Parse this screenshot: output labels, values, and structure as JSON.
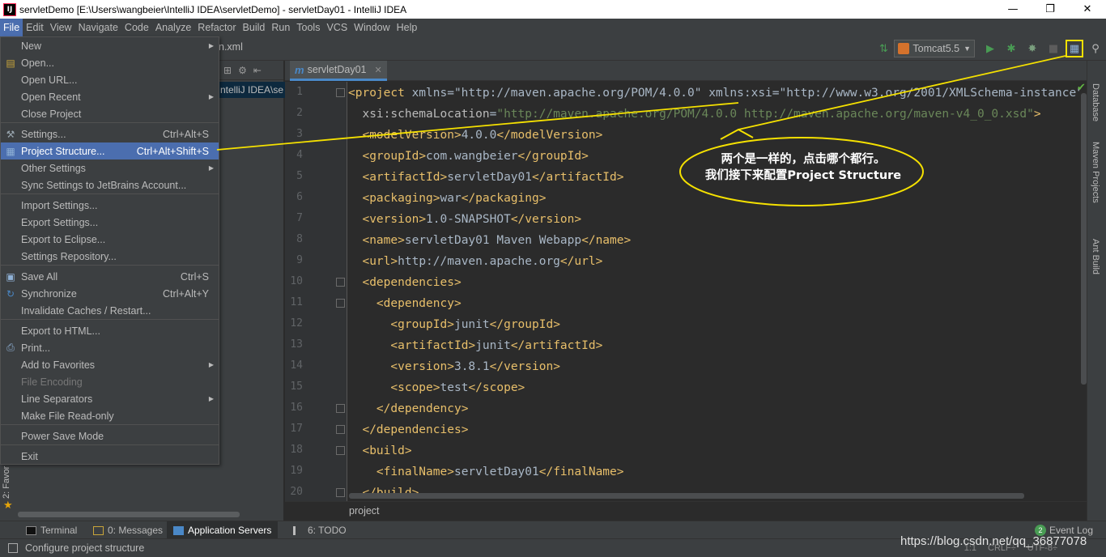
{
  "window": {
    "title": "servletDemo [E:\\Users\\wangbeier\\IntelliJ IDEA\\servletDemo] - servletDay01 - IntelliJ IDEA",
    "app_icon": "IJ"
  },
  "menubar": [
    "File",
    "Edit",
    "View",
    "Navigate",
    "Code",
    "Analyze",
    "Refactor",
    "Build",
    "Run",
    "Tools",
    "VCS",
    "Window",
    "Help"
  ],
  "navbar": {
    "breadcrumb_tail": "n.xml"
  },
  "run_config": {
    "name": "Tomcat5.5"
  },
  "project_panel": {
    "path_fragment": "ntelliJ IDEA\\se"
  },
  "editor": {
    "tab_label": "servletDay01",
    "breadcrumb": "project",
    "line_numbers": [
      "1",
      "2",
      "3",
      "4",
      "5",
      "6",
      "7",
      "8",
      "9",
      "10",
      "11",
      "12",
      "13",
      "14",
      "15",
      "16",
      "17",
      "18",
      "19",
      "20"
    ],
    "lines": [
      "<project xmlns=\"http://maven.apache.org/POM/4.0.0\" xmlns:xsi=\"http://www.w3.org/2001/XMLSchema-instance\"",
      "  xsi:schemaLocation=\"http://maven.apache.org/POM/4.0.0 http://maven.apache.org/maven-v4_0_0.xsd\">",
      "  <modelVersion>4.0.0</modelVersion>",
      "  <groupId>com.wangbeier</groupId>",
      "  <artifactId>servletDay01</artifactId>",
      "  <packaging>war</packaging>",
      "  <version>1.0-SNAPSHOT</version>",
      "  <name>servletDay01 Maven Webapp</name>",
      "  <url>http://maven.apache.org</url>",
      "  <dependencies>",
      "    <dependency>",
      "      <groupId>junit</groupId>",
      "      <artifactId>junit</artifactId>",
      "      <version>3.8.1</version>",
      "      <scope>test</scope>",
      "    </dependency>",
      "  </dependencies>",
      "  <build>",
      "    <finalName>servletDay01</finalName>",
      "  </build>"
    ]
  },
  "file_menu": {
    "items": [
      {
        "label": "New",
        "shortcut": "",
        "submenu": true
      },
      {
        "label": "Open...",
        "shortcut": "",
        "icon": "folder-icon"
      },
      {
        "label": "Open URL...",
        "shortcut": ""
      },
      {
        "label": "Open Recent",
        "shortcut": "",
        "submenu": true
      },
      {
        "label": "Close Project",
        "shortcut": ""
      },
      {
        "label": "Settings...",
        "shortcut": "Ctrl+Alt+S",
        "icon": "wrench-icon"
      },
      {
        "label": "Project Structure...",
        "shortcut": "Ctrl+Alt+Shift+S",
        "icon": "project-structure-icon",
        "selected": true
      },
      {
        "label": "Other Settings",
        "shortcut": "",
        "submenu": true
      },
      {
        "label": "Sync Settings to JetBrains Account...",
        "shortcut": ""
      },
      {
        "label": "Import Settings...",
        "shortcut": ""
      },
      {
        "label": "Export Settings...",
        "shortcut": ""
      },
      {
        "label": "Export to Eclipse...",
        "shortcut": ""
      },
      {
        "label": "Settings Repository...",
        "shortcut": ""
      },
      {
        "label": "Save All",
        "shortcut": "Ctrl+S",
        "icon": "save-icon"
      },
      {
        "label": "Synchronize",
        "shortcut": "Ctrl+Alt+Y",
        "icon": "sync-icon"
      },
      {
        "label": "Invalidate Caches / Restart...",
        "shortcut": ""
      },
      {
        "label": "Export to HTML...",
        "shortcut": ""
      },
      {
        "label": "Print...",
        "shortcut": "",
        "icon": "print-icon"
      },
      {
        "label": "Add to Favorites",
        "shortcut": "",
        "submenu": true
      },
      {
        "label": "File Encoding",
        "shortcut": "",
        "disabled": true
      },
      {
        "label": "Line Separators",
        "shortcut": "",
        "submenu": true
      },
      {
        "label": "Make File Read-only",
        "shortcut": ""
      },
      {
        "label": "Power Save Mode",
        "shortcut": ""
      },
      {
        "label": "Exit",
        "shortcut": ""
      }
    ]
  },
  "right_strip": [
    "Database",
    "Maven Projects",
    "Ant Build"
  ],
  "left_strip": {
    "favorites_label": "2: Favor"
  },
  "bottom_tools": [
    {
      "label": "Terminal",
      "active": false
    },
    {
      "label": "0: Messages",
      "active": false
    },
    {
      "label": "Application Servers",
      "active": true
    },
    {
      "label": "6: TODO",
      "active": false
    }
  ],
  "event_log": {
    "label": "Event Log",
    "count": "2"
  },
  "status": {
    "text": "Configure project structure",
    "right_info": [
      "1:1",
      "CRLF÷",
      "UTF-8÷"
    ]
  },
  "annotation": {
    "line1": "两个是一样的，点击哪个都行。",
    "line2": "我们接下来配置Project Structure",
    "color": "#f5e100"
  },
  "watermark": "https://blog.csdn.net/qq_36877078",
  "colors": {
    "menu_selected": "#4b6eaf",
    "tag": "#e8bf6a",
    "value": "#6a8759",
    "background": "#2b2b2b",
    "panel": "#3c3f41"
  }
}
